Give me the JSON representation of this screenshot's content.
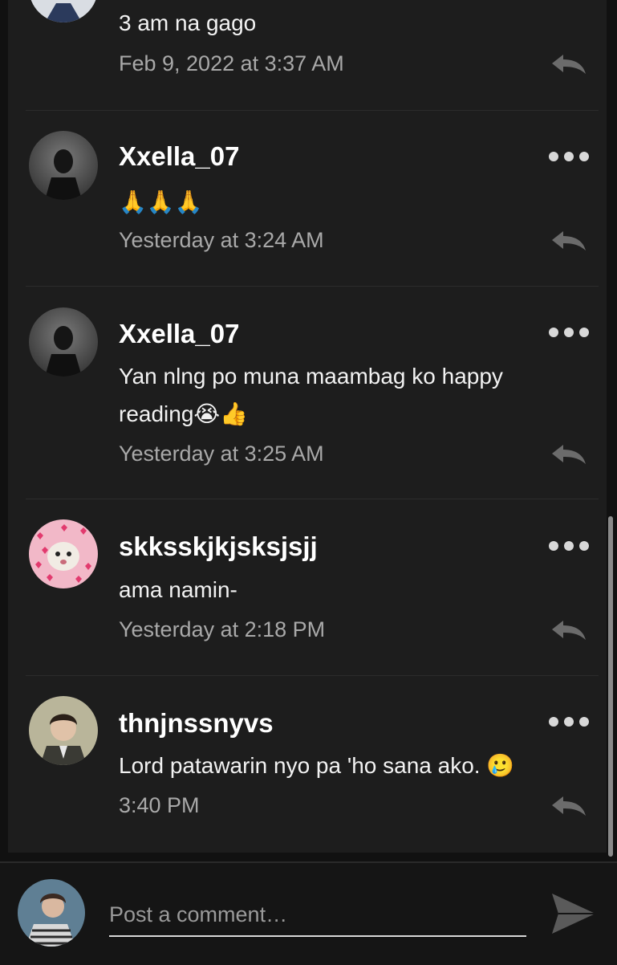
{
  "comments": [
    {
      "username": "",
      "text": "3 am na gago",
      "timestamp": "Feb 9, 2022 at 3:37 AM"
    },
    {
      "username": "Xxella_07",
      "text": "🙏🙏🙏",
      "timestamp": "Yesterday at 3:24 AM"
    },
    {
      "username": "Xxella_07",
      "text_line1": "Yan nlng po muna maambag ko happy",
      "text_line2": "reading😭👍",
      "timestamp": "Yesterday at 3:25 AM"
    },
    {
      "username": "skksskjkjsksjsjj",
      "text": "ama namin-",
      "timestamp": "Yesterday at 2:18 PM"
    },
    {
      "username": "thnjnssnyvs",
      "text": "Lord patawarin nyo pa 'ho sana ako. 🥲",
      "timestamp": "3:40 PM"
    }
  ],
  "composer": {
    "placeholder": "Post a comment…"
  },
  "icons": {
    "more": "more-options-icon",
    "reply": "reply-icon",
    "send": "send-icon"
  },
  "colors": {
    "background": "#111111",
    "panel": "#1d1d1d",
    "text": "#ffffff",
    "muted": "#a9a9a9"
  }
}
